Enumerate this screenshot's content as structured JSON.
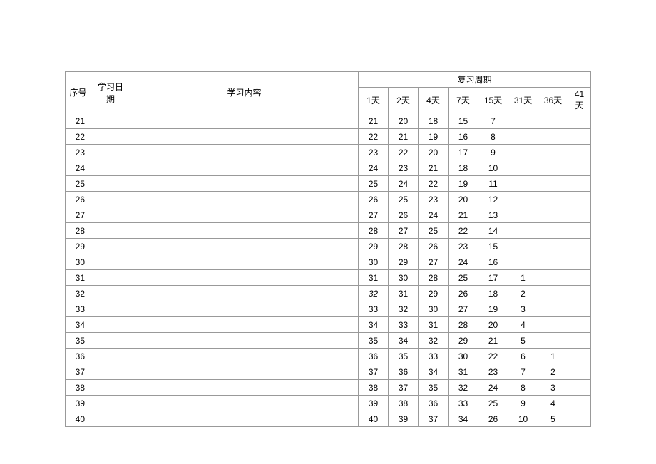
{
  "headers": {
    "seq": "序号",
    "date": "学习日期",
    "content": "学习内容",
    "review_period": "复习周期",
    "days": [
      "1天",
      "2天",
      "4天",
      "7天",
      "15天",
      "31天",
      "36天",
      "41天"
    ]
  },
  "rows": [
    {
      "seq": "21",
      "date": "",
      "content": "",
      "d1": "21",
      "d2": "20",
      "d4": "18",
      "d7": "15",
      "d15": "7",
      "d31": "",
      "d36": "",
      "d41": ""
    },
    {
      "seq": "22",
      "date": "",
      "content": "",
      "d1": "22",
      "d2": "21",
      "d4": "19",
      "d7": "16",
      "d15": "8",
      "d31": "",
      "d36": "",
      "d41": ""
    },
    {
      "seq": "23",
      "date": "",
      "content": "",
      "d1": "23",
      "d2": "22",
      "d4": "20",
      "d7": "17",
      "d15": "9",
      "d31": "",
      "d36": "",
      "d41": ""
    },
    {
      "seq": "24",
      "date": "",
      "content": "",
      "d1": "24",
      "d2": "23",
      "d4": "21",
      "d7": "18",
      "d15": "10",
      "d31": "",
      "d36": "",
      "d41": ""
    },
    {
      "seq": "25",
      "date": "",
      "content": "",
      "d1": "25",
      "d2": "24",
      "d4": "22",
      "d7": "19",
      "d15": "11",
      "d31": "",
      "d36": "",
      "d41": ""
    },
    {
      "seq": "26",
      "date": "",
      "content": "",
      "d1": "26",
      "d2": "25",
      "d4": "23",
      "d7": "20",
      "d15": "12",
      "d31": "",
      "d36": "",
      "d41": ""
    },
    {
      "seq": "27",
      "date": "",
      "content": "",
      "d1": "27",
      "d2": "26",
      "d4": "24",
      "d7": "21",
      "d15": "13",
      "d31": "",
      "d36": "",
      "d41": ""
    },
    {
      "seq": "28",
      "date": "",
      "content": "",
      "d1": "28",
      "d2": "27",
      "d4": "25",
      "d7": "22",
      "d15": "14",
      "d31": "",
      "d36": "",
      "d41": ""
    },
    {
      "seq": "29",
      "date": "",
      "content": "",
      "d1": "29",
      "d2": "28",
      "d4": "26",
      "d7": "23",
      "d15": "15",
      "d31": "",
      "d36": "",
      "d41": ""
    },
    {
      "seq": "30",
      "date": "",
      "content": "",
      "d1": "30",
      "d2": "29",
      "d4": "27",
      "d7": "24",
      "d15": "16",
      "d31": "",
      "d36": "",
      "d41": ""
    },
    {
      "seq": "31",
      "date": "",
      "content": "",
      "d1": "31",
      "d2": "30",
      "d4": "28",
      "d7": "25",
      "d15": "17",
      "d31": "1",
      "d36": "",
      "d41": ""
    },
    {
      "seq": "32",
      "date": "",
      "content": "",
      "d1": "32",
      "d2": "31",
      "d4": "29",
      "d7": "26",
      "d15": "18",
      "d31": "2",
      "d36": "",
      "d41": "",
      "italic_d1": true
    },
    {
      "seq": "33",
      "date": "",
      "content": "",
      "d1": "33",
      "d2": "32",
      "d4": "30",
      "d7": "27",
      "d15": "19",
      "d31": "3",
      "d36": "",
      "d41": ""
    },
    {
      "seq": "34",
      "date": "",
      "content": "",
      "d1": "34",
      "d2": "33",
      "d4": "31",
      "d7": "28",
      "d15": "20",
      "d31": "4",
      "d36": "",
      "d41": ""
    },
    {
      "seq": "35",
      "date": "",
      "content": "",
      "d1": "35",
      "d2": "34",
      "d4": "32",
      "d7": "29",
      "d15": "21",
      "d31": "5",
      "d36": "",
      "d41": ""
    },
    {
      "seq": "36",
      "date": "",
      "content": "",
      "d1": "36",
      "d2": "35",
      "d4": "33",
      "d7": "30",
      "d15": "22",
      "d31": "6",
      "d36": "1",
      "d41": ""
    },
    {
      "seq": "37",
      "date": "",
      "content": "",
      "d1": "37",
      "d2": "36",
      "d4": "34",
      "d7": "31",
      "d15": "23",
      "d31": "7",
      "d36": "2",
      "d41": ""
    },
    {
      "seq": "38",
      "date": "",
      "content": "",
      "d1": "38",
      "d2": "37",
      "d4": "35",
      "d7": "32",
      "d15": "24",
      "d31": "8",
      "d36": "3",
      "d41": ""
    },
    {
      "seq": "39",
      "date": "",
      "content": "",
      "d1": "39",
      "d2": "38",
      "d4": "36",
      "d7": "33",
      "d15": "25",
      "d31": "9",
      "d36": "4",
      "d41": ""
    },
    {
      "seq": "40",
      "date": "",
      "content": "",
      "d1": "40",
      "d2": "39",
      "d4": "37",
      "d7": "34",
      "d15": "26",
      "d31": "10",
      "d36": "5",
      "d41": ""
    }
  ],
  "chart_data": {
    "type": "table",
    "title": "复习周期",
    "columns": [
      "序号",
      "学习日期",
      "学习内容",
      "1天",
      "2天",
      "4天",
      "7天",
      "15天",
      "31天",
      "36天",
      "41天"
    ],
    "series": [
      {
        "name": "1天",
        "values": [
          21,
          22,
          23,
          24,
          25,
          26,
          27,
          28,
          29,
          30,
          31,
          32,
          33,
          34,
          35,
          36,
          37,
          38,
          39,
          40
        ]
      },
      {
        "name": "2天",
        "values": [
          20,
          21,
          22,
          23,
          24,
          25,
          26,
          27,
          28,
          29,
          30,
          31,
          32,
          33,
          34,
          35,
          36,
          37,
          38,
          39
        ]
      },
      {
        "name": "4天",
        "values": [
          18,
          19,
          20,
          21,
          22,
          23,
          24,
          25,
          26,
          27,
          28,
          29,
          30,
          31,
          32,
          33,
          34,
          35,
          36,
          37
        ]
      },
      {
        "name": "7天",
        "values": [
          15,
          16,
          17,
          18,
          19,
          20,
          21,
          22,
          23,
          24,
          25,
          26,
          27,
          28,
          29,
          30,
          31,
          32,
          33,
          34
        ]
      },
      {
        "name": "15天",
        "values": [
          7,
          8,
          9,
          10,
          11,
          12,
          13,
          14,
          15,
          16,
          17,
          18,
          19,
          20,
          21,
          22,
          23,
          24,
          25,
          26
        ]
      },
      {
        "name": "31天",
        "values": [
          null,
          null,
          null,
          null,
          null,
          null,
          null,
          null,
          null,
          null,
          1,
          2,
          3,
          4,
          5,
          6,
          7,
          8,
          9,
          10
        ]
      },
      {
        "name": "36天",
        "values": [
          null,
          null,
          null,
          null,
          null,
          null,
          null,
          null,
          null,
          null,
          null,
          null,
          null,
          null,
          null,
          1,
          2,
          3,
          4,
          5
        ]
      },
      {
        "name": "41天",
        "values": [
          null,
          null,
          null,
          null,
          null,
          null,
          null,
          null,
          null,
          null,
          null,
          null,
          null,
          null,
          null,
          null,
          null,
          null,
          null,
          null
        ]
      }
    ],
    "categories": [
      21,
      22,
      23,
      24,
      25,
      26,
      27,
      28,
      29,
      30,
      31,
      32,
      33,
      34,
      35,
      36,
      37,
      38,
      39,
      40
    ]
  }
}
